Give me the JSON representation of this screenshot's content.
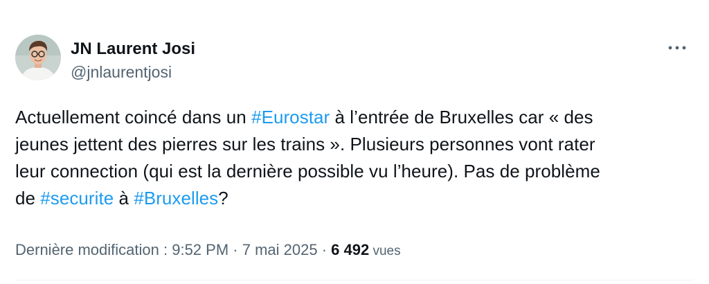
{
  "author": {
    "display_name": "JN Laurent Josi",
    "handle": "@jnlaurentjosi",
    "avatar_icon": "profile-photo"
  },
  "more_icon": "ellipsis-icon",
  "text": {
    "line1": {
      "before": "Actuellement coincé dans un ",
      "hashtag": "#Eurostar",
      "after": " à l’entrée de Bruxelles car « des"
    },
    "line2": "jeunes jettent des pierres sur les trains ». Plusieurs personnes vont rater",
    "line3": "leur connection (qui est la dernière possible vu l’heure). Pas de problème",
    "line4": {
      "before": "de ",
      "hashtag1": "#securite",
      "middle": " à ",
      "hashtag2": "#Bruxelles",
      "after": "?"
    }
  },
  "meta": {
    "modified_label": "Dernière modification : ",
    "time": "9:52 PM",
    "sep1": " · ",
    "date": "7 mai 2025",
    "sep2": " · ",
    "views_count": "6 492",
    "views_label": " vues"
  },
  "colors": {
    "hashtag": "#1d9bf0",
    "secondary_text": "#536471",
    "primary_text": "#0f1419"
  }
}
